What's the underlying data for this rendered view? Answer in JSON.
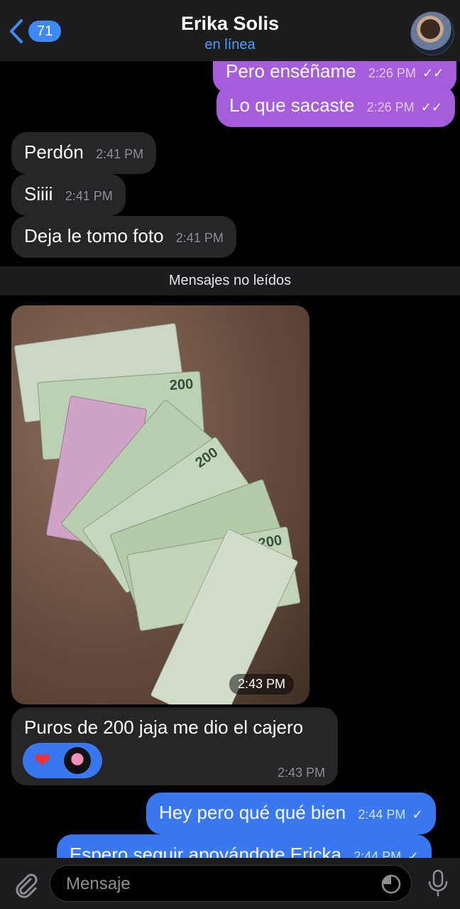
{
  "header": {
    "back_count": "71",
    "title": "Erika Solis",
    "status": "en línea"
  },
  "messages": [
    {
      "text": "Pero enséñame",
      "time": "2:26 PM"
    },
    {
      "text": "Lo que sacaste",
      "time": "2:26 PM"
    },
    {
      "text": "Perdón",
      "time": "2:41 PM"
    },
    {
      "text": "Siiii",
      "time": "2:41 PM"
    },
    {
      "text": "Deja le tomo foto",
      "time": "2:41 PM"
    },
    {
      "text": "Puros de 200 jaja me dio el cajero",
      "time": "2:43 PM"
    },
    {
      "text": "Hey pero qué qué bien",
      "time": "2:44 PM"
    },
    {
      "text": "Espero seguir apoyándote Ericka",
      "time": "2:44 PM"
    }
  ],
  "divider": "Mensajes no leídos",
  "photo": {
    "time": "2:43 PM",
    "bill_label": "200"
  },
  "reactions": {
    "heart": "❤",
    "icons": [
      "heart-icon",
      "avatar-reaction"
    ]
  },
  "input": {
    "placeholder": "Mensaje"
  },
  "colors": {
    "outgoing_purple": "#a55ddb",
    "outgoing_blue": "#3a78f2",
    "incoming": "#262628",
    "accent": "#4f9cff"
  }
}
